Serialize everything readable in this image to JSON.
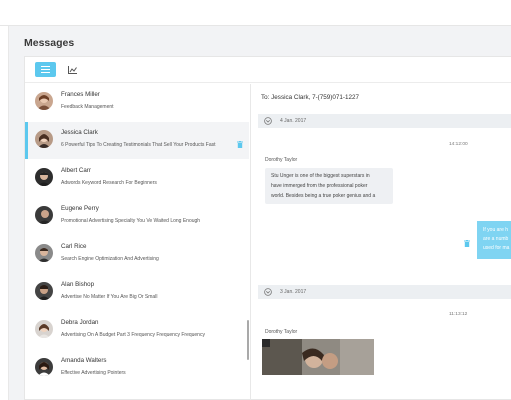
{
  "page": {
    "title": "Messages"
  },
  "toolbar": {
    "list_icon": "list-icon",
    "chart_icon": "chart-icon"
  },
  "conversations": [
    {
      "name": "Frances Miller",
      "snippet": "Feedback Management",
      "active": false
    },
    {
      "name": "Jessica Clark",
      "snippet": "6 Powerful Tips To Creating Testimonials That Sell Your Products Fast",
      "active": true
    },
    {
      "name": "Albert Carr",
      "snippet": "Adwords Keyword Research For Beginners",
      "active": false
    },
    {
      "name": "Eugene Perry",
      "snippet": "Promotional Advertising Specialty You Ve Waited Long Enough",
      "active": false
    },
    {
      "name": "Carl Rice",
      "snippet": "Search Engine Optimization And Advertising",
      "active": false
    },
    {
      "name": "Alan Bishop",
      "snippet": "Advertise No Matter If You Are Big Or Small",
      "active": false
    },
    {
      "name": "Debra Jordan",
      "snippet": "Advertising On A Budget Part 3 Frequency Frequency Frequency",
      "active": false
    },
    {
      "name": "Amanda Walters",
      "snippet": "Effective Advertising Pointers",
      "active": false
    }
  ],
  "chat": {
    "to": "To: Jessica Clark, 7-(759)071-1227",
    "groups": [
      {
        "date": "4 Jan. 2017",
        "time": "14:12:00",
        "sender": "Dorothy Taylor",
        "incoming_lines": [
          "Stu Unger is one of the biggest superstars in",
          "have immerged from the professional poker",
          "world. Besides being a true poker genius and a"
        ],
        "outgoing_lines": [
          "If you are h",
          "are a numb",
          "used for ma"
        ]
      },
      {
        "date": "3 Jan. 2017",
        "time": "11:13:12",
        "sender": "Dorothy Taylor"
      }
    ]
  },
  "colors": {
    "accent": "#5cc8ee",
    "outgoing_bubble": "#7fd4f2"
  }
}
